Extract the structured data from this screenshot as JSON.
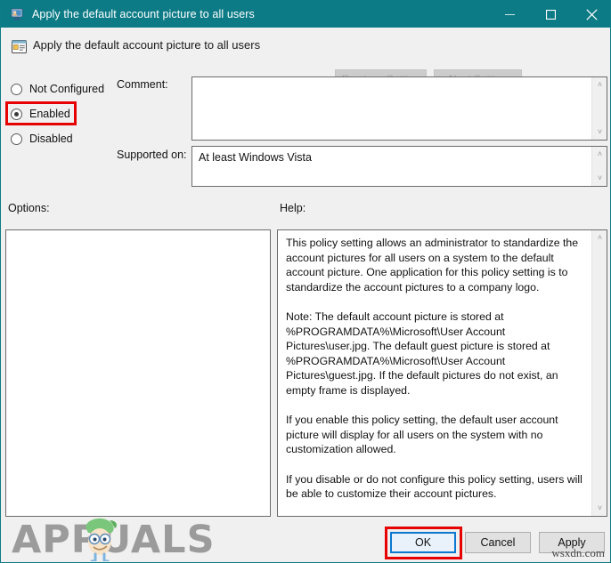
{
  "window": {
    "title": "Apply the default account picture to all users",
    "title_icon": "monitor-user-icon",
    "controls": {
      "minimize": "minimize-icon",
      "maximize": "maximize-icon",
      "close": "close-icon"
    },
    "accent_color": "#0c7b86",
    "chrome_bg": "#f0f0f0"
  },
  "header": {
    "icon": "policy-setting-icon",
    "title": "Apply the default account picture to all users",
    "previous_button": "Previous Setting",
    "next_button": "Next Setting"
  },
  "state_options": [
    {
      "label": "Not Configured",
      "selected": false
    },
    {
      "label": "Enabled",
      "selected": true
    },
    {
      "label": "Disabled",
      "selected": false
    }
  ],
  "fields": {
    "comment_label": "Comment:",
    "comment_value": "",
    "supported_label": "Supported on:",
    "supported_value": "At least Windows Vista"
  },
  "sections": {
    "options_label": "Options:",
    "help_label": "Help:"
  },
  "help_text": "This policy setting allows an administrator to standardize the account pictures for all users on a system to the default account picture. One application for this policy setting is to standardize the account pictures to a company logo.\n\nNote: The default account picture is stored at %PROGRAMDATA%\\Microsoft\\User Account Pictures\\user.jpg. The default guest picture is stored at %PROGRAMDATA%\\Microsoft\\User Account Pictures\\guest.jpg. If the default pictures do not exist, an empty frame is displayed.\n\nIf you enable this policy setting, the default user account picture will display for all users on the system with no customization allowed.\n\nIf you disable or do not configure this policy setting, users will be able to customize their account pictures.",
  "buttons": {
    "ok": "OK",
    "cancel": "Cancel",
    "apply": "Apply"
  },
  "highlights": {
    "color": "#e60000",
    "targets": [
      "Enabled",
      "OK"
    ]
  },
  "watermarks": {
    "brand": "APPUALS",
    "site": "wsxdn.com"
  },
  "scroll_arrows": {
    "up": "˄",
    "down": "˅"
  }
}
